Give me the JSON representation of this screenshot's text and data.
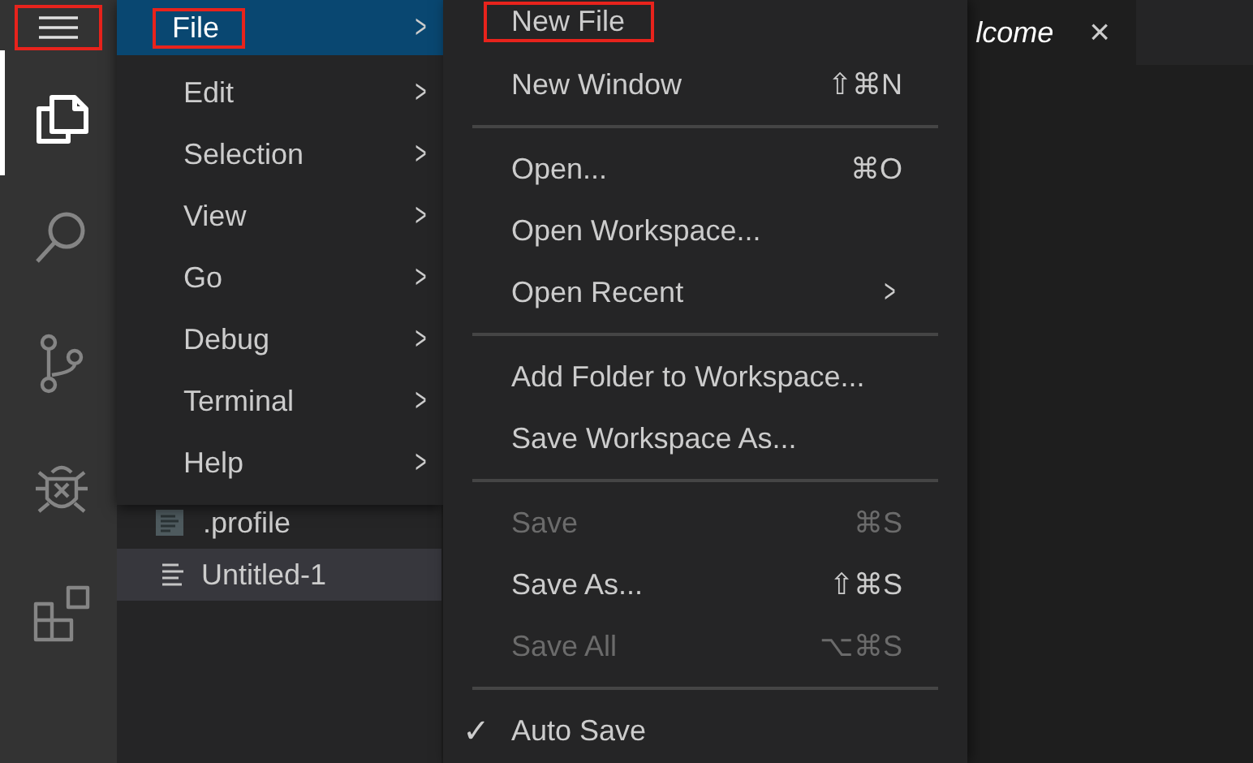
{
  "activity_bar": {
    "menu_button": {
      "annotated": true
    },
    "items": [
      {
        "kind": "files",
        "selected": true
      },
      {
        "kind": "search",
        "selected": false
      },
      {
        "kind": "source-control",
        "selected": false
      },
      {
        "kind": "debug",
        "selected": false
      },
      {
        "kind": "extensions",
        "selected": false
      }
    ]
  },
  "explorer": {
    "files": [
      {
        "name": ".profile",
        "kind": "text",
        "selected": false
      },
      {
        "name": "Untitled-1",
        "kind": "lines",
        "selected": true
      }
    ]
  },
  "editor": {
    "tabs": [
      {
        "label": "lcome",
        "close": "×"
      }
    ]
  },
  "menu": {
    "items": [
      {
        "label": "File",
        "selected": true,
        "annotated": true,
        "chevron": ">"
      },
      {
        "label": "Edit",
        "selected": false,
        "annotated": false,
        "chevron": ">"
      },
      {
        "label": "Selection",
        "selected": false,
        "annotated": false,
        "chevron": ">"
      },
      {
        "label": "View",
        "selected": false,
        "annotated": false,
        "chevron": ">"
      },
      {
        "label": "Go",
        "selected": false,
        "annotated": false,
        "chevron": ">"
      },
      {
        "label": "Debug",
        "selected": false,
        "annotated": false,
        "chevron": ">"
      },
      {
        "label": "Terminal",
        "selected": false,
        "annotated": false,
        "chevron": ">"
      },
      {
        "label": "Help",
        "selected": false,
        "annotated": false,
        "chevron": ">"
      }
    ]
  },
  "file_menu": {
    "items": [
      {
        "kind": "item",
        "label": "New File",
        "annotated": true,
        "disabled": false
      },
      {
        "kind": "item",
        "label": "New Window",
        "shortcut": "⇧⌘N",
        "annotated": false,
        "disabled": false
      },
      {
        "kind": "separator"
      },
      {
        "kind": "item",
        "label": "Open...",
        "shortcut": "⌘O",
        "annotated": false,
        "disabled": false
      },
      {
        "kind": "item",
        "label": "Open Workspace...",
        "annotated": false,
        "disabled": false
      },
      {
        "kind": "item",
        "label": "Open Recent",
        "chevron": ">",
        "annotated": false,
        "disabled": false
      },
      {
        "kind": "separator"
      },
      {
        "kind": "item",
        "label": "Add Folder to Workspace...",
        "annotated": false,
        "disabled": false
      },
      {
        "kind": "item",
        "label": "Save Workspace As...",
        "annotated": false,
        "disabled": false
      },
      {
        "kind": "separator"
      },
      {
        "kind": "item",
        "label": "Save",
        "shortcut": "⌘S",
        "annotated": false,
        "disabled": true
      },
      {
        "kind": "item",
        "label": "Save As...",
        "shortcut": "⇧⌘S",
        "annotated": false,
        "disabled": false
      },
      {
        "kind": "item",
        "label": "Save All",
        "shortcut": "⌥⌘S",
        "annotated": false,
        "disabled": true
      },
      {
        "kind": "separator"
      },
      {
        "kind": "item",
        "label": "Auto Save",
        "check": "✓",
        "annotated": false,
        "disabled": false,
        "checked": true
      }
    ]
  }
}
